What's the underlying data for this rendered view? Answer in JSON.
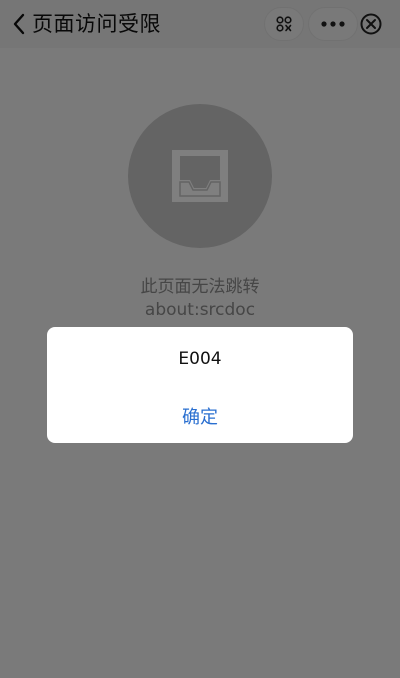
{
  "header": {
    "title": "页面访问受限"
  },
  "content": {
    "message": "此页面无法跳转",
    "url": "about:srcdoc"
  },
  "dialog": {
    "message": "E004",
    "confirm_label": "确定"
  },
  "colors": {
    "accent": "#2a6fd0",
    "mask": "rgba(0,0,0,0.5)"
  },
  "icons": {
    "back": "chevron-left-icon",
    "scan": "scan-icon",
    "more": "more-dots-icon",
    "close": "close-circle-icon",
    "empty": "inbox-tray-icon"
  }
}
